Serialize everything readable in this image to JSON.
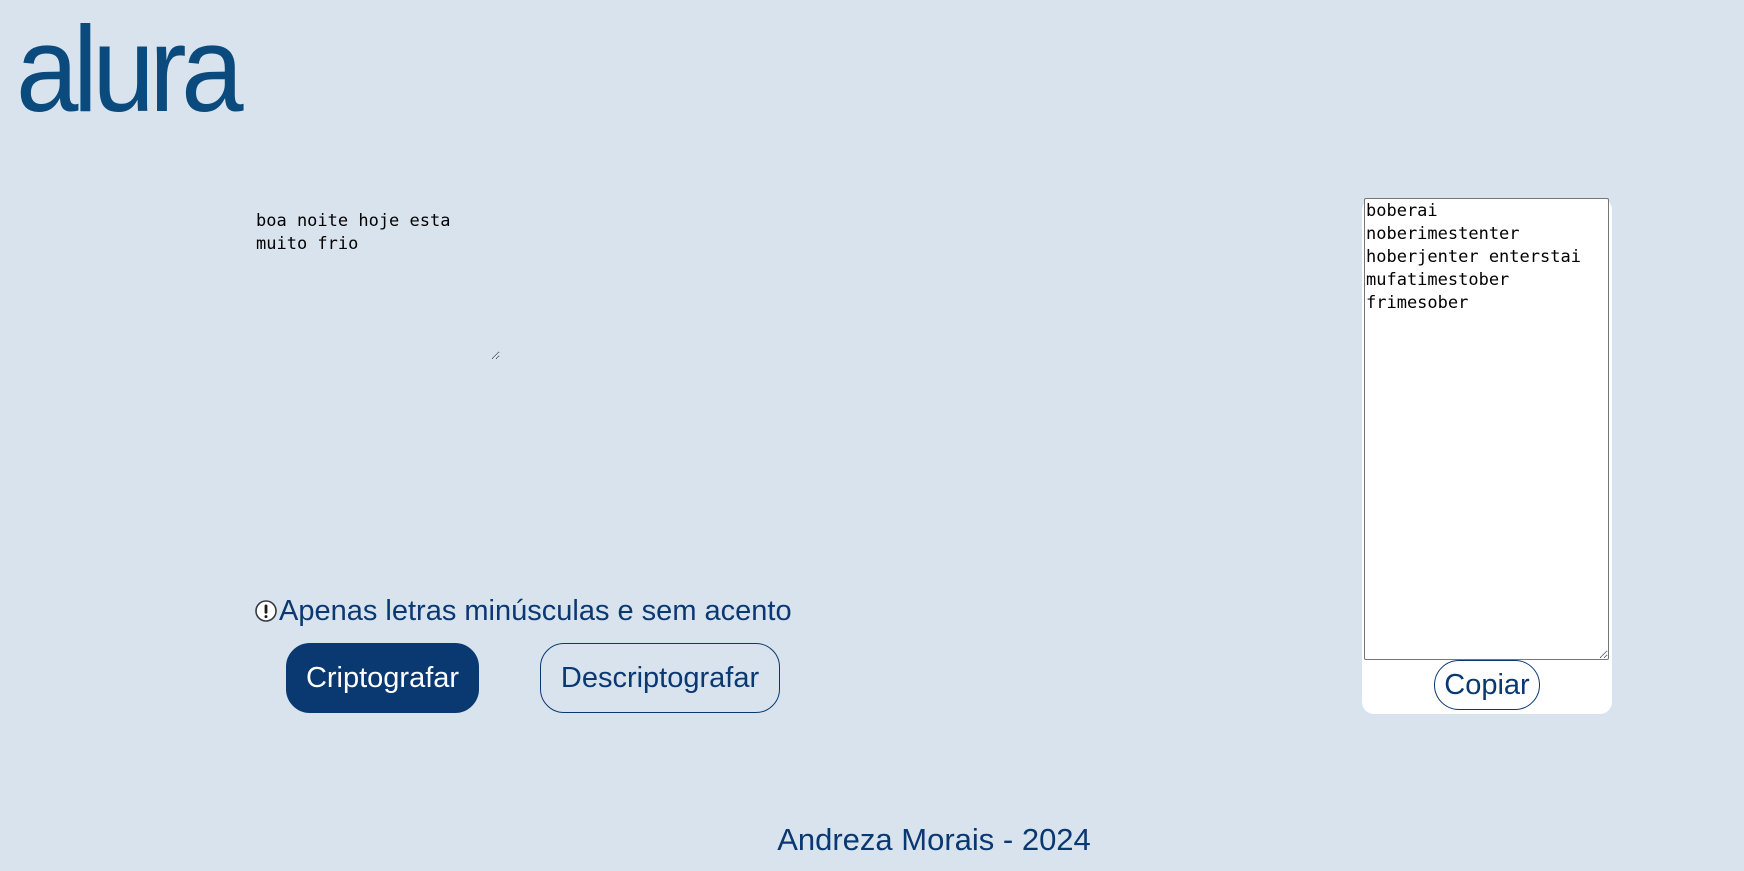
{
  "header": {
    "logo_text": "alura",
    "logo_color": "#0a4a7c"
  },
  "input": {
    "value": "boa noite hoje esta\nmuito frio"
  },
  "warning": {
    "icon": "exclamation-circle-icon",
    "text": "Apenas letras minúsculas e sem acento"
  },
  "buttons": {
    "encrypt_label": "Criptografar",
    "decrypt_label": "Descriptografar"
  },
  "output": {
    "value": "boberai\nnoberimestenter\nhoberjenter enterstai\nmufatimestober\nfrimesober",
    "copy_label": "Copiar"
  },
  "footer": {
    "text": "Andreza Morais - 2024"
  },
  "colors": {
    "background": "#d9e3ee",
    "primary": "#0a3871",
    "panel": "#ffffff"
  }
}
